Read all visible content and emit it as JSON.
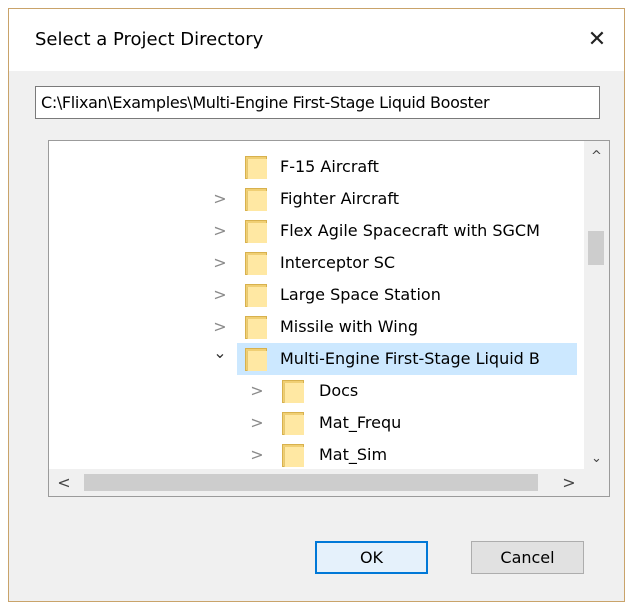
{
  "dialog": {
    "title": "Select a Project Directory",
    "close_glyph": "✕",
    "path_value": "C:\\Flixan\\Examples\\Multi-Engine First-Stage Liquid Booster"
  },
  "tree": {
    "items": [
      {
        "label": "F-15 Aircraft",
        "level": 1,
        "chevron": "",
        "selected": false
      },
      {
        "label": "Fighter Aircraft",
        "level": 1,
        "chevron": ">",
        "selected": false
      },
      {
        "label": "Flex Agile Spacecraft with SGCM",
        "level": 1,
        "chevron": ">",
        "selected": false
      },
      {
        "label": "Interceptor SC",
        "level": 1,
        "chevron": ">",
        "selected": false
      },
      {
        "label": "Large Space Station",
        "level": 1,
        "chevron": ">",
        "selected": false
      },
      {
        "label": "Missile with Wing",
        "level": 1,
        "chevron": ">",
        "selected": false
      },
      {
        "label": "Multi-Engine First-Stage Liquid B",
        "level": 1,
        "chevron": "⌄",
        "selected": true
      },
      {
        "label": "Docs",
        "level": 2,
        "chevron": ">",
        "selected": false
      },
      {
        "label": "Mat_Frequ",
        "level": 2,
        "chevron": ">",
        "selected": false
      },
      {
        "label": "Mat_Sim",
        "level": 2,
        "chevron": ">",
        "selected": false
      }
    ],
    "scroll_up_glyph": "^",
    "scroll_down_glyph": "⌄",
    "scroll_left_glyph": "<",
    "scroll_right_glyph": ">"
  },
  "buttons": {
    "ok_label": "OK",
    "cancel_label": "Cancel"
  },
  "colors": {
    "selection": "#cce8ff",
    "accent": "#0078d7",
    "folder": "#f0cf74"
  }
}
